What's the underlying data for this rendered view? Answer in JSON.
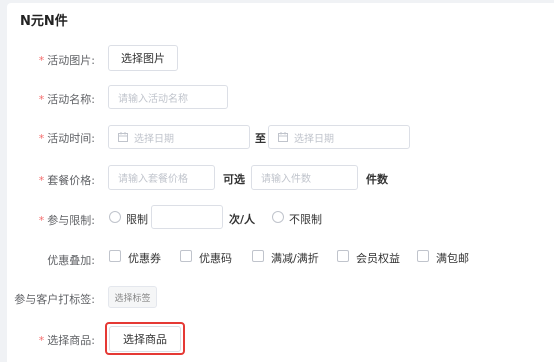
{
  "page": {
    "title": "N元N件"
  },
  "colors": {
    "required_mark": "#f56c6c",
    "highlight_box": "#e53935"
  },
  "form": {
    "required_mark": "*",
    "activity_image": {
      "label": "活动图片:",
      "button": "选择图片"
    },
    "activity_name": {
      "label": "活动名称:",
      "placeholder": "请输入活动名称"
    },
    "activity_time": {
      "label": "活动时间:",
      "start_placeholder": "选择日期",
      "separator": "至",
      "end_placeholder": "选择日期",
      "icon": "calendar-icon"
    },
    "package_price": {
      "label": "套餐价格:",
      "price_placeholder": "请输入套餐价格",
      "optional_text": "可选",
      "count_placeholder": "请输入件数",
      "unit": "件数"
    },
    "participation_limit": {
      "label": "参与限制:",
      "limit_option": "限制",
      "times_unit": "次/人",
      "no_limit_option": "不限制"
    },
    "discount_stack": {
      "label": "优惠叠加:",
      "options": [
        "优惠券",
        "优惠码",
        "满减/满折",
        "会员权益",
        "满包邮"
      ]
    },
    "customer_tag": {
      "label": "参与客户打标签:",
      "button": "选择标签"
    },
    "select_product": {
      "label": "选择商品:",
      "button": "选择商品"
    }
  }
}
